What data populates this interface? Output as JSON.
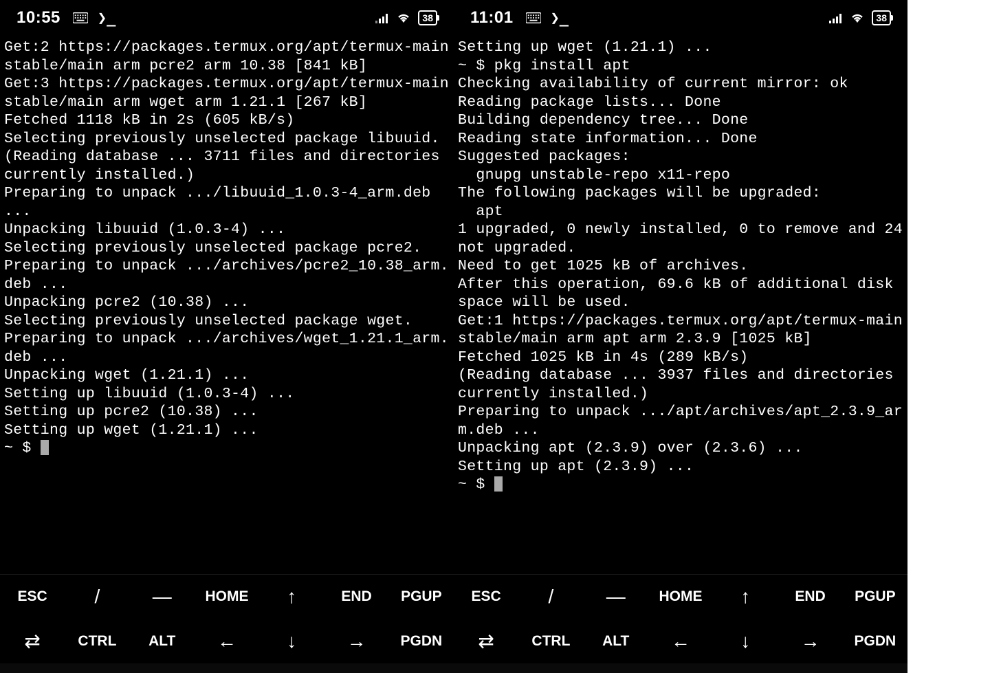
{
  "left": {
    "time": "10:55",
    "battery": "38",
    "terminal": "Get:2 https://packages.termux.org/apt/termux-main stable/main arm pcre2 arm 10.38 [841 kB]\nGet:3 https://packages.termux.org/apt/termux-main stable/main arm wget arm 1.21.1 [267 kB]\nFetched 1118 kB in 2s (605 kB/s)\nSelecting previously unselected package libuuid.\n(Reading database ... 3711 files and directories currently installed.)\nPreparing to unpack .../libuuid_1.0.3-4_arm.deb ...\nUnpacking libuuid (1.0.3-4) ...\nSelecting previously unselected package pcre2.\nPreparing to unpack .../archives/pcre2_10.38_arm.deb ...\nUnpacking pcre2 (10.38) ...\nSelecting previously unselected package wget.\nPreparing to unpack .../archives/wget_1.21.1_arm.deb ...\nUnpacking wget (1.21.1) ...\nSetting up libuuid (1.0.3-4) ...\nSetting up pcre2 (10.38) ...\nSetting up wget (1.21.1) ...",
    "prompt": "~ $ "
  },
  "right": {
    "time": "11:01",
    "battery": "38",
    "terminal": "Setting up wget (1.21.1) ...\n~ $ pkg install apt\nChecking availability of current mirror: ok\nReading package lists... Done\nBuilding dependency tree... Done\nReading state information... Done\nSuggested packages:\n  gnupg unstable-repo x11-repo\nThe following packages will be upgraded:\n  apt\n1 upgraded, 0 newly installed, 0 to remove and 24 not upgraded.\nNeed to get 1025 kB of archives.\nAfter this operation, 69.6 kB of additional disk space will be used.\nGet:1 https://packages.termux.org/apt/termux-main stable/main arm apt arm 2.3.9 [1025 kB]\nFetched 1025 kB in 4s (289 kB/s)\n(Reading database ... 3937 files and directories currently installed.)\nPreparing to unpack .../apt/archives/apt_2.3.9_arm.deb ...\nUnpacking apt (2.3.9) over (2.3.6) ...\nSetting up apt (2.3.9) ...",
    "prompt": "~ $ "
  },
  "keys": {
    "row1": [
      "ESC",
      "/",
      "—",
      "HOME",
      "↑",
      "END",
      "PGUP"
    ],
    "row2_icon": "⇄",
    "row2": [
      "CTRL",
      "ALT",
      "←",
      "↓",
      "→",
      "PGDN"
    ]
  }
}
